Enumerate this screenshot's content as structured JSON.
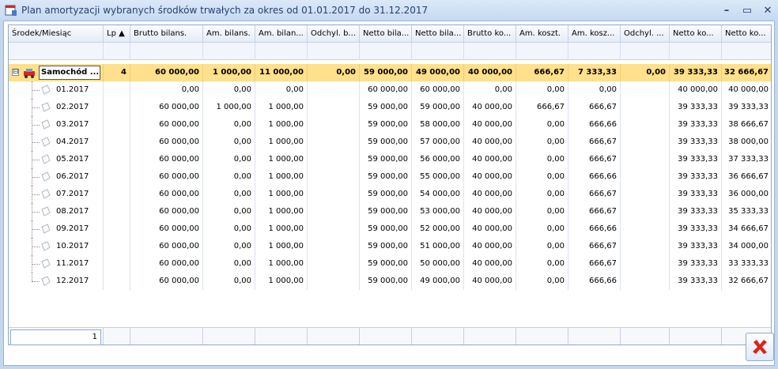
{
  "window": {
    "title": "Plan amortyzacji wybranych środków trwałych za okres od 01.01.2017 do 31.12.2017",
    "minimize": "–",
    "maximize": "▭",
    "close": "✕"
  },
  "columns": [
    "Środek/Miesiąc",
    "Lp ▲",
    "Brutto bilans.",
    "Am. bilans.",
    "Am. bilan...",
    "Odchyl. b...",
    "Netto bila...",
    "Netto bila...",
    "Brutto ko...",
    "Am. koszt.",
    "Am. kosz...",
    "Odchyl. ...",
    "Netto ko...",
    "Netto ko..."
  ],
  "group": {
    "expander": "⊟",
    "label": "Samochód ...",
    "cells": [
      "4",
      "60 000,00",
      "1 000,00",
      "11 000,00",
      "0,00",
      "59 000,00",
      "49 000,00",
      "40 000,00",
      "666,67",
      "7 333,33",
      "0,00",
      "39 333,33",
      "32 666,67"
    ]
  },
  "rows": [
    {
      "month": "01.2017",
      "cells": [
        "",
        "0,00",
        "0,00",
        "0,00",
        "",
        "60 000,00",
        "60 000,00",
        "0,00",
        "0,00",
        "0,00",
        "",
        "40 000,00",
        "40 000,00"
      ]
    },
    {
      "month": "02.2017",
      "cells": [
        "",
        "60 000,00",
        "1 000,00",
        "1 000,00",
        "",
        "59 000,00",
        "59 000,00",
        "40 000,00",
        "666,67",
        "666,67",
        "",
        "39 333,33",
        "39 333,33"
      ]
    },
    {
      "month": "03.2017",
      "cells": [
        "",
        "60 000,00",
        "0,00",
        "1 000,00",
        "",
        "59 000,00",
        "58 000,00",
        "40 000,00",
        "0,00",
        "666,66",
        "",
        "39 333,33",
        "38 666,67"
      ]
    },
    {
      "month": "04.2017",
      "cells": [
        "",
        "60 000,00",
        "0,00",
        "1 000,00",
        "",
        "59 000,00",
        "57 000,00",
        "40 000,00",
        "0,00",
        "666,67",
        "",
        "39 333,33",
        "38 000,00"
      ]
    },
    {
      "month": "05.2017",
      "cells": [
        "",
        "60 000,00",
        "0,00",
        "1 000,00",
        "",
        "59 000,00",
        "56 000,00",
        "40 000,00",
        "0,00",
        "666,67",
        "",
        "39 333,33",
        "37 333,33"
      ]
    },
    {
      "month": "06.2017",
      "cells": [
        "",
        "60 000,00",
        "0,00",
        "1 000,00",
        "",
        "59 000,00",
        "55 000,00",
        "40 000,00",
        "0,00",
        "666,66",
        "",
        "39 333,33",
        "36 666,67"
      ]
    },
    {
      "month": "07.2017",
      "cells": [
        "",
        "60 000,00",
        "0,00",
        "1 000,00",
        "",
        "59 000,00",
        "54 000,00",
        "40 000,00",
        "0,00",
        "666,67",
        "",
        "39 333,33",
        "36 000,00"
      ]
    },
    {
      "month": "08.2017",
      "cells": [
        "",
        "60 000,00",
        "0,00",
        "1 000,00",
        "",
        "59 000,00",
        "53 000,00",
        "40 000,00",
        "0,00",
        "666,67",
        "",
        "39 333,33",
        "35 333,33"
      ]
    },
    {
      "month": "09.2017",
      "cells": [
        "",
        "60 000,00",
        "0,00",
        "1 000,00",
        "",
        "59 000,00",
        "52 000,00",
        "40 000,00",
        "0,00",
        "666,66",
        "",
        "39 333,33",
        "34 666,67"
      ]
    },
    {
      "month": "10.2017",
      "cells": [
        "",
        "60 000,00",
        "0,00",
        "1 000,00",
        "",
        "59 000,00",
        "51 000,00",
        "40 000,00",
        "0,00",
        "666,67",
        "",
        "39 333,33",
        "34 000,00"
      ]
    },
    {
      "month": "11.2017",
      "cells": [
        "",
        "60 000,00",
        "0,00",
        "1 000,00",
        "",
        "59 000,00",
        "50 000,00",
        "40 000,00",
        "0,00",
        "666,67",
        "",
        "39 333,33",
        "33 333,33"
      ]
    },
    {
      "month": "12.2017",
      "cells": [
        "",
        "60 000,00",
        "0,00",
        "1 000,00",
        "",
        "59 000,00",
        "49 000,00",
        "40 000,00",
        "0,00",
        "666,66",
        "",
        "39 333,33",
        "32 666,67"
      ]
    }
  ],
  "footer": {
    "count": "1"
  },
  "colors": {
    "group_row": "#ffe08c",
    "accent": "#27416b",
    "cancel_icon": "#d9251c"
  },
  "icons": {
    "app": "calendar-icon",
    "group": "car-icon",
    "row": "document-icon",
    "cancel": "cancel-x-icon"
  }
}
